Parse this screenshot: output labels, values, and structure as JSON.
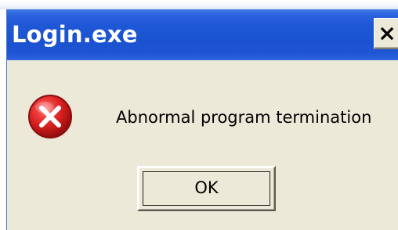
{
  "window": {
    "title": "Login.exe"
  },
  "dialog": {
    "message": "Abnormal program termination",
    "ok_label": "OK",
    "icon": "error-icon",
    "close_icon": "close-icon"
  },
  "colors": {
    "titlebar_blue": "#1f58d7",
    "dialog_bg": "#ece9d8",
    "error_red": "#d31c1c",
    "text_black": "#000000",
    "white": "#ffffff"
  }
}
